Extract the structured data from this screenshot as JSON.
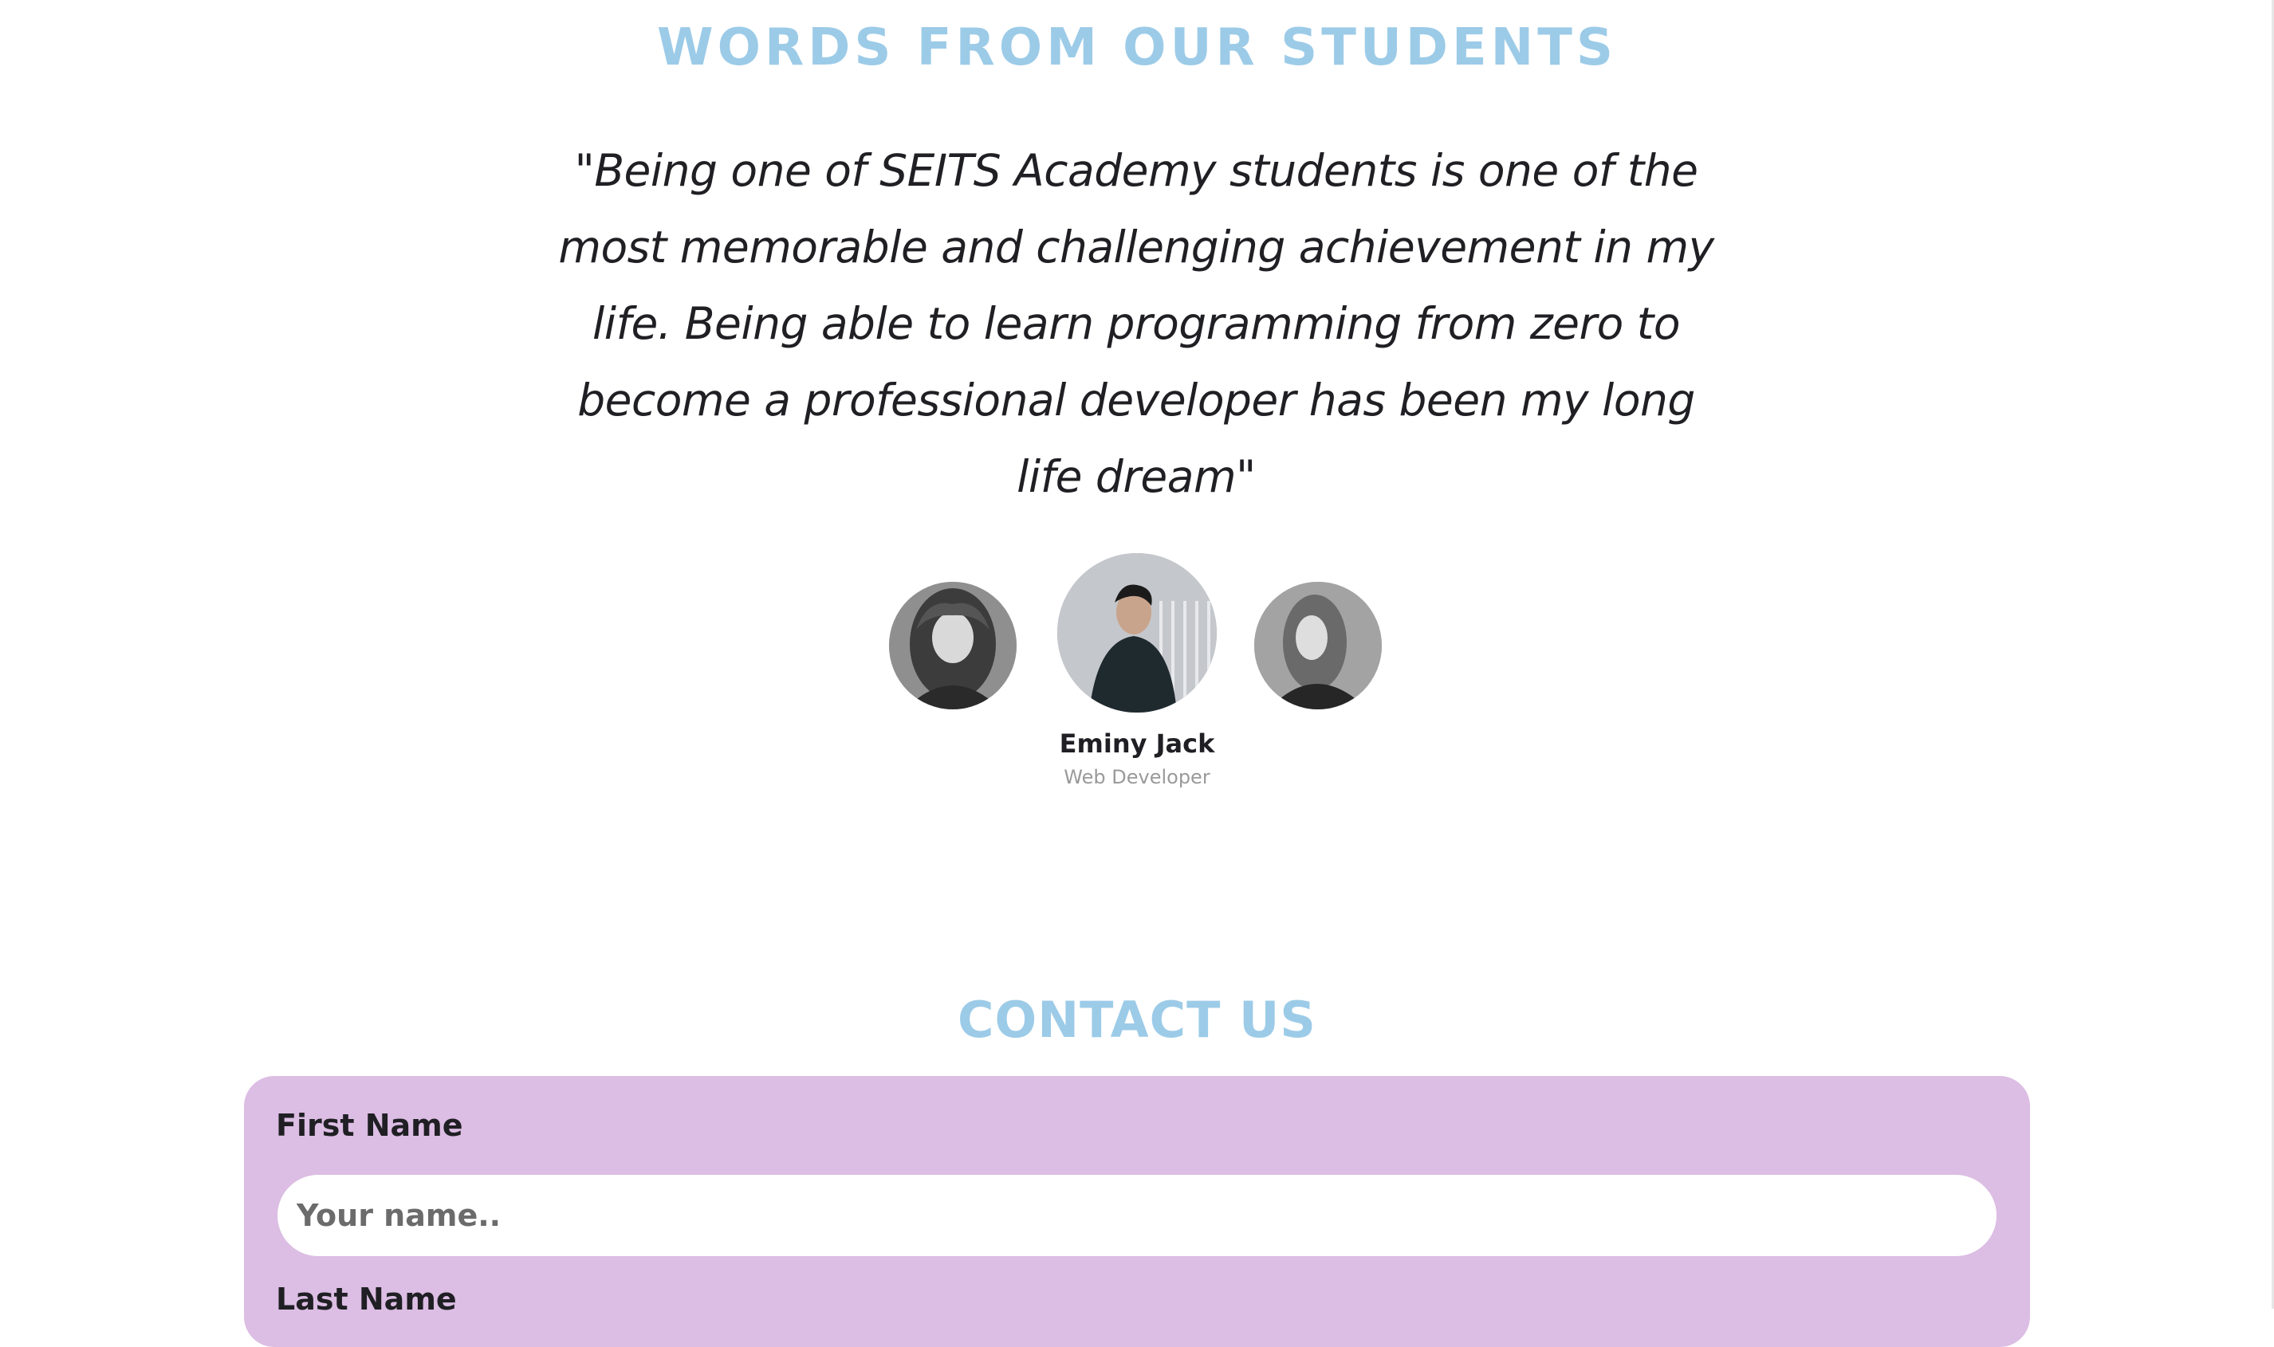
{
  "testimonials": {
    "heading": "WORDS FROM OUR STUDENTS",
    "quote": "\"Being one of SEITS Academy students is one of the most memorable and challenging achievement in my life. Being able to learn programming from zero to become a professional developer has been my long life dream\"",
    "active_student": {
      "name": "Eminy Jack",
      "role": "Web Developer"
    },
    "avatars": [
      "student-avatar-left",
      "student-avatar-center",
      "student-avatar-right"
    ]
  },
  "contact": {
    "heading": "CONTACT US",
    "first_name_label": "First Name",
    "first_name_placeholder": "Your name..",
    "first_name_value": "",
    "last_name_label": "Last Name",
    "card_color": "#dcbde3"
  },
  "colors": {
    "accent": "#9ccbe8",
    "text": "#1f1f24",
    "muted": "#9a9a9a"
  }
}
